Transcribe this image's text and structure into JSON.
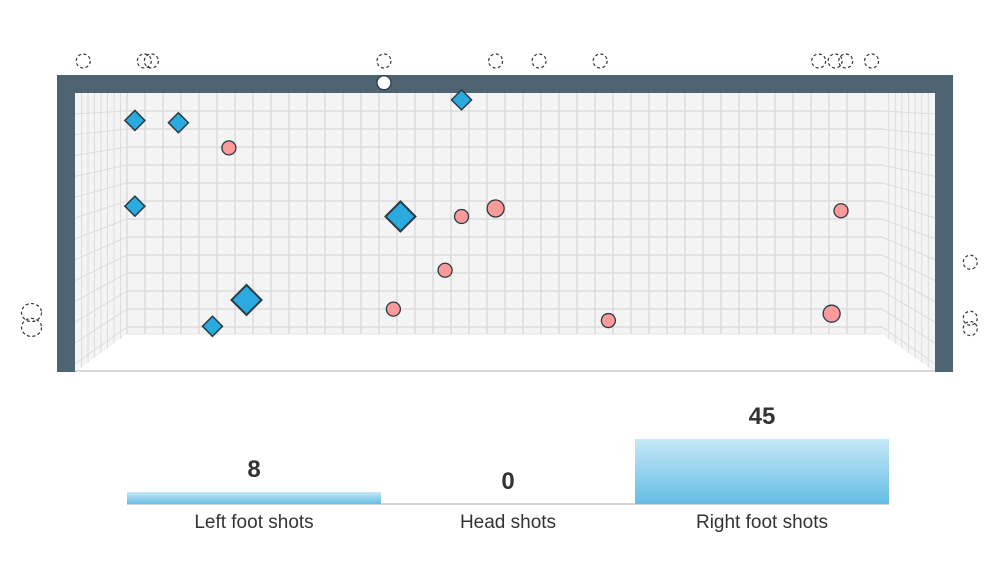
{
  "colors": {
    "frame": "#4f6473",
    "net_bg": "#f4f4f4",
    "net_line": "#dcdcdc",
    "diamond": "#29abe0",
    "circle": "#fb9a9a",
    "woodwork": "#ffffff",
    "marker_stroke": "#2b3a42"
  },
  "chart_data": [
    {
      "type": "scatter",
      "x_units": "goal width (m)",
      "y_units": "height (m)",
      "xlim": [
        0,
        7.32
      ],
      "ylim": [
        0,
        2.44
      ],
      "shots": [
        {
          "shape": "diamond",
          "outcome": "on-target",
          "size": "small",
          "x": 0.51,
          "y": 2.2
        },
        {
          "shape": "diamond",
          "outcome": "on-target",
          "size": "small",
          "x": 0.88,
          "y": 2.18
        },
        {
          "shape": "diamond",
          "outcome": "on-target",
          "size": "small",
          "x": 0.51,
          "y": 1.45
        },
        {
          "shape": "diamond",
          "outcome": "on-target",
          "size": "small",
          "x": 1.17,
          "y": 0.4
        },
        {
          "shape": "diamond",
          "outcome": "on-target",
          "size": "large",
          "x": 1.46,
          "y": 0.63
        },
        {
          "shape": "diamond",
          "outcome": "on-target",
          "size": "large",
          "x": 2.77,
          "y": 1.36
        },
        {
          "shape": "diamond",
          "outcome": "on-target",
          "size": "small",
          "x": 3.29,
          "y": 2.38
        },
        {
          "shape": "circle",
          "outcome": "on-target",
          "size": "small",
          "x": 1.31,
          "y": 1.96
        },
        {
          "shape": "circle",
          "outcome": "on-target",
          "size": "small",
          "x": 3.29,
          "y": 1.36
        },
        {
          "shape": "circle",
          "outcome": "on-target",
          "size": "large",
          "x": 3.58,
          "y": 1.43
        },
        {
          "shape": "circle",
          "outcome": "on-target",
          "size": "small",
          "x": 3.15,
          "y": 0.89
        },
        {
          "shape": "circle",
          "outcome": "on-target",
          "size": "small",
          "x": 2.71,
          "y": 0.55
        },
        {
          "shape": "circle",
          "outcome": "on-target",
          "size": "small",
          "x": 4.54,
          "y": 0.45
        },
        {
          "shape": "circle",
          "outcome": "on-target",
          "size": "small",
          "x": 6.52,
          "y": 1.41
        },
        {
          "shape": "circle",
          "outcome": "on-target",
          "size": "large",
          "x": 6.44,
          "y": 0.51
        },
        {
          "shape": "circle",
          "outcome": "woodwork",
          "size": "small",
          "x": 2.63,
          "y": 2.53
        },
        {
          "shape": "circle",
          "outcome": "off-target",
          "size": "small",
          "x": 0.07,
          "y": 2.72
        },
        {
          "shape": "circle",
          "outcome": "off-target",
          "size": "small",
          "x": 0.59,
          "y": 2.72
        },
        {
          "shape": "circle",
          "outcome": "off-target",
          "size": "small",
          "x": 0.65,
          "y": 2.72
        },
        {
          "shape": "circle",
          "outcome": "off-target",
          "size": "small",
          "x": 2.63,
          "y": 2.72
        },
        {
          "shape": "circle",
          "outcome": "off-target",
          "size": "small",
          "x": 3.58,
          "y": 2.72
        },
        {
          "shape": "circle",
          "outcome": "off-target",
          "size": "small",
          "x": 3.95,
          "y": 2.72
        },
        {
          "shape": "circle",
          "outcome": "off-target",
          "size": "small",
          "x": 4.47,
          "y": 2.72
        },
        {
          "shape": "circle",
          "outcome": "off-target",
          "size": "small",
          "x": 6.33,
          "y": 2.72
        },
        {
          "shape": "circle",
          "outcome": "off-target",
          "size": "small",
          "x": 6.47,
          "y": 2.72
        },
        {
          "shape": "circle",
          "outcome": "off-target",
          "size": "small",
          "x": 6.56,
          "y": 2.72
        },
        {
          "shape": "circle",
          "outcome": "off-target",
          "size": "small",
          "x": 6.78,
          "y": 2.72
        },
        {
          "shape": "circle",
          "outcome": "off-target",
          "size": "large",
          "x": -0.37,
          "y": 0.52
        },
        {
          "shape": "circle",
          "outcome": "off-target",
          "size": "large",
          "x": -0.37,
          "y": 0.39
        },
        {
          "shape": "circle",
          "outcome": "off-target",
          "size": "small",
          "x": 7.62,
          "y": 0.96
        },
        {
          "shape": "circle",
          "outcome": "off-target",
          "size": "small",
          "x": 7.62,
          "y": 0.47
        },
        {
          "shape": "circle",
          "outcome": "off-target",
          "size": "small",
          "x": 7.62,
          "y": 0.38
        }
      ]
    },
    {
      "type": "bar",
      "categories": [
        "Left foot shots",
        "Head shots",
        "Right foot shots"
      ],
      "values": [
        8,
        0,
        45
      ],
      "value_labels": [
        "8",
        "0",
        "45"
      ],
      "ylim": [
        0,
        45
      ]
    }
  ]
}
